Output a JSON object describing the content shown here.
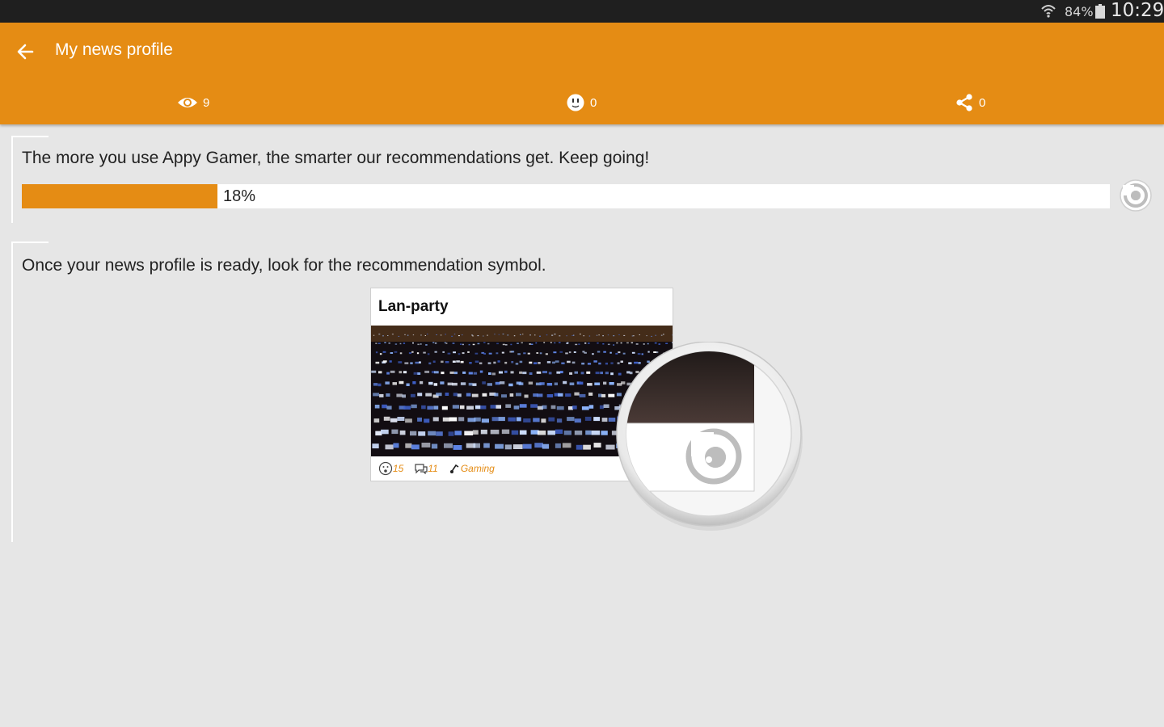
{
  "status_bar": {
    "battery": "84%",
    "time": "10:29",
    "icons": [
      "wifi-icon",
      "battery-icon"
    ]
  },
  "app_bar": {
    "title": "My news profile",
    "back_icon": "arrow-left-icon",
    "stats": [
      {
        "icon": "eye-icon",
        "value": "9"
      },
      {
        "icon": "smiley-icon",
        "value": "0"
      },
      {
        "icon": "share-icon",
        "value": "0"
      }
    ]
  },
  "progress_card": {
    "message": "The more you use Appy Gamer, the smarter our recommendations get. Keep going!",
    "progress_label": "18%",
    "progress_fraction": 0.18,
    "icon": "recommendation-symbol-icon"
  },
  "info_card": {
    "message": "Once your news profile is ready, look for the recommendation symbol.",
    "example": {
      "title": "Lan-party",
      "reactions": "15",
      "comments": "11",
      "category": "Gaming"
    }
  },
  "colors": {
    "accent": "#e58c14",
    "background": "#e6e6e6",
    "status_bar": "#1f1f1f"
  }
}
